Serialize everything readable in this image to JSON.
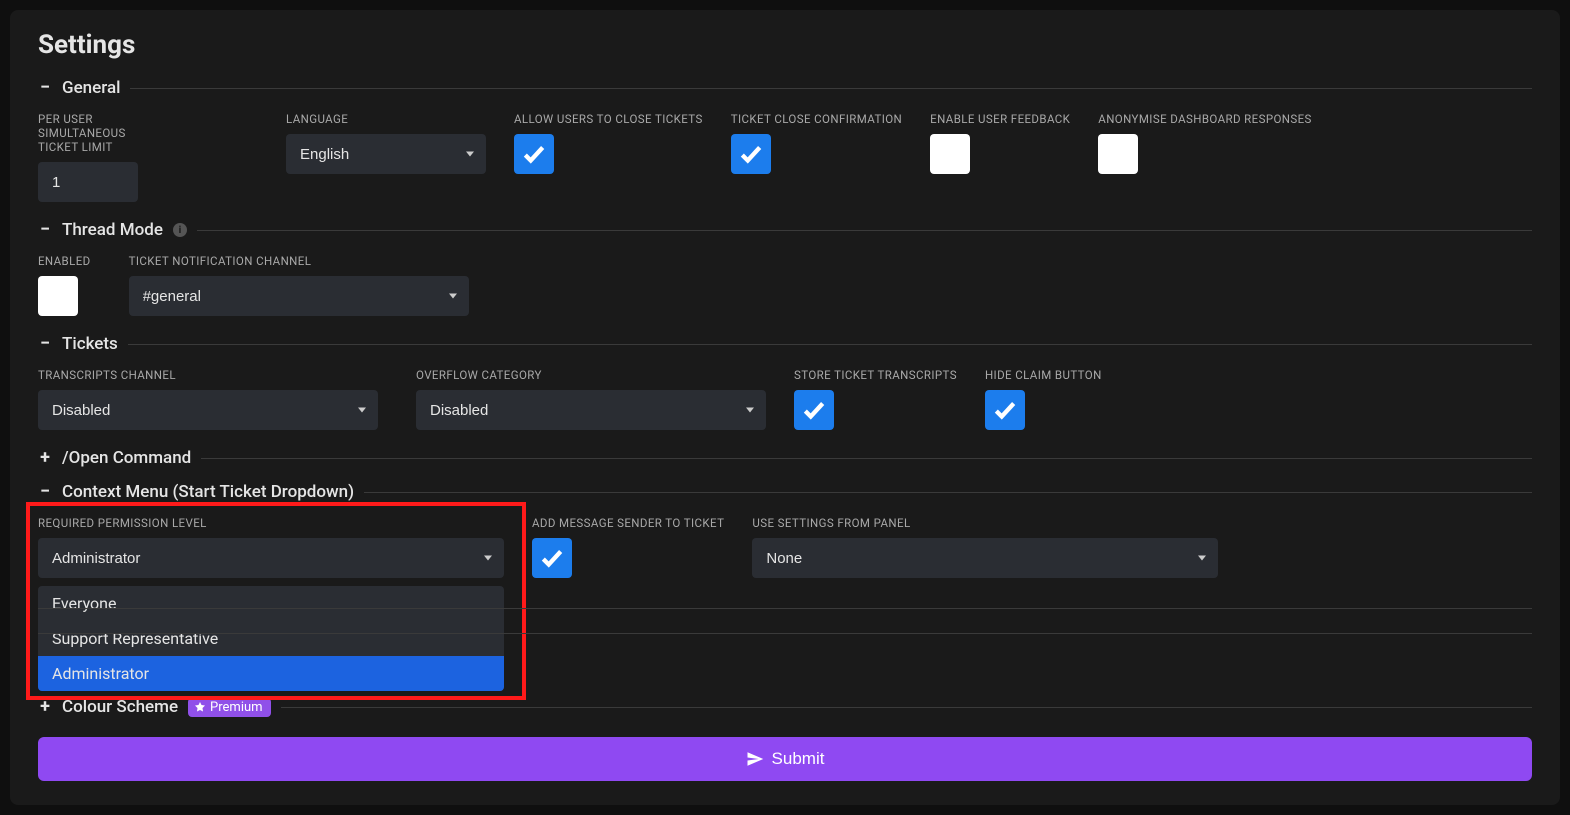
{
  "title": "Settings",
  "sections": {
    "general": {
      "title": "General",
      "ticket_limit_label": "PER USER SIMULTANEOUS TICKET LIMIT",
      "ticket_limit_value": "1",
      "language_label": "LANGUAGE",
      "language_value": "English",
      "allow_close_label": "ALLOW USERS TO CLOSE TICKETS",
      "close_confirm_label": "TICKET CLOSE CONFIRMATION",
      "feedback_label": "ENABLE USER FEEDBACK",
      "anonymise_label": "ANONYMISE DASHBOARD RESPONSES"
    },
    "thread": {
      "title": "Thread Mode",
      "enabled_label": "ENABLED",
      "notif_label": "TICKET NOTIFICATION CHANNEL",
      "notif_value": "#general"
    },
    "tickets": {
      "title": "Tickets",
      "transcripts_label": "TRANSCRIPTS CHANNEL",
      "transcripts_value": "Disabled",
      "overflow_label": "OVERFLOW CATEGORY",
      "overflow_value": "Disabled",
      "store_label": "STORE TICKET TRANSCRIPTS",
      "hide_claim_label": "HIDE CLAIM BUTTON"
    },
    "open_cmd": {
      "title": "/Open Command"
    },
    "context": {
      "title": "Context Menu (Start Ticket Dropdown)",
      "perm_label": "REQUIRED PERMISSION LEVEL",
      "perm_value": "Administrator",
      "perm_options": [
        "Everyone",
        "Support Representative",
        "Administrator"
      ],
      "add_sender_label": "ADD MESSAGE SENDER TO TICKET",
      "panel_label": "USE SETTINGS FROM PANEL",
      "panel_value": "None"
    },
    "colour": {
      "title": "Colour Scheme",
      "badge": "Premium"
    }
  },
  "submit_label": "Submit"
}
